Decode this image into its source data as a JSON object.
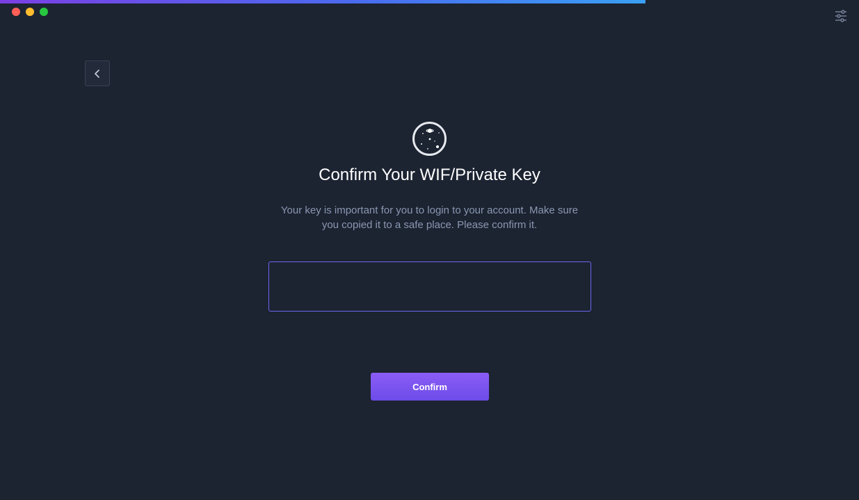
{
  "header": {
    "progress_percent": 75,
    "progress_color_start": "#7b3fe4",
    "progress_color_end": "#3aa0f5",
    "settings_icon": "sliders-icon"
  },
  "window_controls": {
    "close_color": "#fe5f57",
    "minimize_color": "#febc2e",
    "maximize_color": "#27c840"
  },
  "navigation": {
    "back_icon": "chevron-left-icon"
  },
  "main": {
    "logo_icon": "planet-logo-icon",
    "title": "Confirm Your WIF/Private Key",
    "description": "Your key is important for you to login to your account. Make sure you copied it to a safe place. Please confirm it.",
    "key_input": {
      "value": "",
      "placeholder": ""
    },
    "confirm_label": "Confirm"
  },
  "colors": {
    "background": "#1c2331",
    "accent": "#6d68f0",
    "button": "#7b55ee",
    "muted_text": "#8a98b2"
  }
}
